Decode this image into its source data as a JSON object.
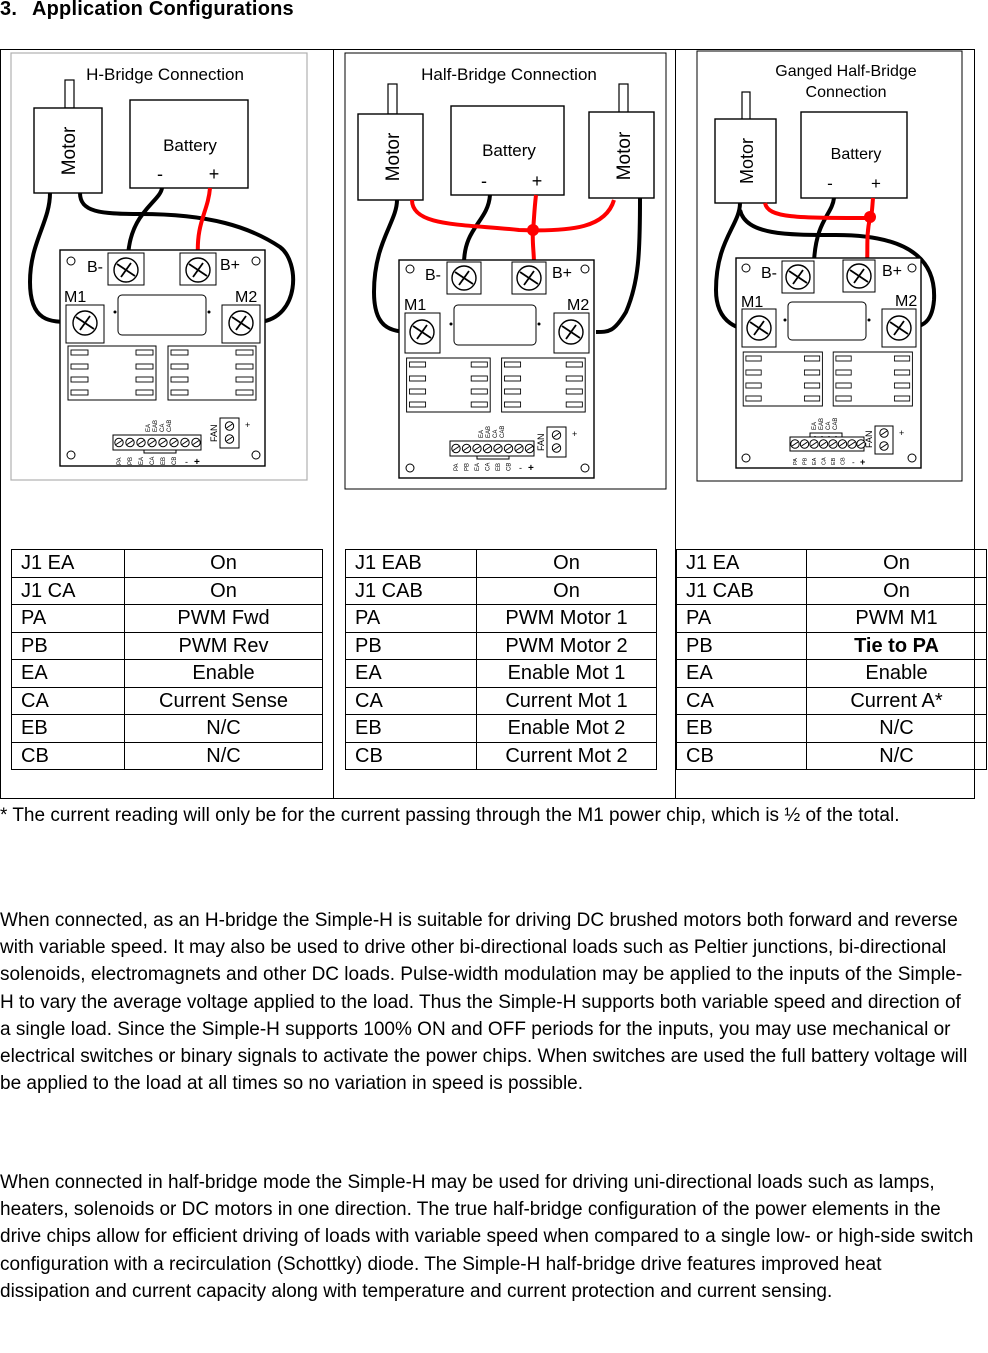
{
  "heading": {
    "number": "3.",
    "title": "Application Configurations"
  },
  "colors": {
    "wire_black": "#000000",
    "wire_red": "#ff0000",
    "panel_border": "#b0b0b0"
  },
  "diagrams": [
    {
      "title_lines": [
        "H-Bridge Connection"
      ],
      "motor_label": "Motor",
      "battery_label": "Battery",
      "battery_minus": "-",
      "battery_plus": "+",
      "board": {
        "b_minus": "B-",
        "b_plus": "B+",
        "m1": "M1",
        "m2": "M2",
        "jumper_labels": [
          "EA",
          "EAB",
          "CA",
          "CAB"
        ],
        "terminal_labels": [
          "PA",
          "PB",
          "EA",
          "CA",
          "EB",
          "CB",
          "-",
          "+"
        ],
        "fan_label": "FAN",
        "fan_plus": "+"
      }
    },
    {
      "title_lines": [
        "Half-Bridge Connection"
      ],
      "motor_label": "Motor",
      "motor2_label": "Motor",
      "battery_label": "Battery",
      "battery_minus": "-",
      "battery_plus": "+",
      "board": {
        "b_minus": "B-",
        "b_plus": "B+",
        "m1": "M1",
        "m2": "M2",
        "jumper_labels": [
          "EA",
          "EAB",
          "CA",
          "CAB"
        ],
        "terminal_labels": [
          "PA",
          "PB",
          "EA",
          "CA",
          "EB",
          "CB",
          "-",
          "+"
        ],
        "fan_label": "FAN",
        "fan_plus": "+"
      }
    },
    {
      "title_lines": [
        "Ganged Half-Bridge",
        "Connection"
      ],
      "motor_label": "Motor",
      "battery_label": "Battery",
      "battery_minus": "-",
      "battery_plus": "+",
      "board": {
        "b_minus": "B-",
        "b_plus": "B+",
        "m1": "M1",
        "m2": "M2",
        "jumper_labels": [
          "EA",
          "EAB",
          "CA",
          "CAB"
        ],
        "terminal_labels": [
          "PA",
          "PB",
          "EA",
          "CA",
          "EB",
          "CB",
          "-",
          "+"
        ],
        "fan_label": "FAN",
        "fan_plus": "+"
      }
    }
  ],
  "tables": [
    {
      "rows": [
        {
          "pin": "J1 EA",
          "value": "On"
        },
        {
          "pin": "J1 CA",
          "value": "On"
        },
        {
          "pin": "PA",
          "value": "PWM Fwd"
        },
        {
          "pin": "PB",
          "value": "PWM Rev"
        },
        {
          "pin": "EA",
          "value": "Enable"
        },
        {
          "pin": "CA",
          "value": "Current Sense"
        },
        {
          "pin": "EB",
          "value": "N/C"
        },
        {
          "pin": "CB",
          "value": "N/C"
        }
      ]
    },
    {
      "rows": [
        {
          "pin": "J1 EAB",
          "value": "On"
        },
        {
          "pin": "J1 CAB",
          "value": "On"
        },
        {
          "pin": "PA",
          "value": "PWM Motor 1"
        },
        {
          "pin": "PB",
          "value": "PWM Motor 2"
        },
        {
          "pin": "EA",
          "value": "Enable Mot 1"
        },
        {
          "pin": "CA",
          "value": "Current Mot 1"
        },
        {
          "pin": "EB",
          "value": "Enable Mot 2"
        },
        {
          "pin": "CB",
          "value": "Current Mot 2"
        }
      ]
    },
    {
      "rows": [
        {
          "pin": "J1 EA",
          "value": "On"
        },
        {
          "pin": "J1 CAB",
          "value": "On"
        },
        {
          "pin": "PA",
          "value": "PWM M1"
        },
        {
          "pin": "PB",
          "value": "Tie to PA",
          "bold": true
        },
        {
          "pin": "EA",
          "value": "Enable"
        },
        {
          "pin": "CA",
          "value": "Current A*"
        },
        {
          "pin": "EB",
          "value": "N/C"
        },
        {
          "pin": "CB",
          "value": "N/C"
        }
      ]
    }
  ],
  "footnote": "* The current reading will only be for the current passing through the M1 power chip, which is ½ of the total.",
  "paragraphs": [
    "When connected, as an H-bridge the Simple-H is suitable for driving DC brushed motors both forward and reverse with variable speed.  It may also be used to drive other bi-directional loads such as Peltier junctions, bi-directional solenoids, electromagnets and other DC loads.  Pulse-width modulation may be applied to the inputs of the Simple-H to vary the average voltage applied to the load.  Thus the Simple-H supports both variable speed and direction of a single load.  Since the Simple-H supports 100% ON and OFF periods for the inputs, you may use mechanical or electrical switches or binary signals to activate the power chips.  When switches are used the full battery voltage will be applied to the load at all times so no variation in speed is possible.",
    "When connected in half-bridge mode the Simple-H may be used for driving uni-directional loads such as lamps, heaters, solenoids or DC motors in one direction.  The true half-bridge configuration of the power elements in the drive chips allow for efficient driving of loads with variable speed when compared to a single low- or high-side switch configuration with a recirculation (Schottky) diode.  The Simple-H half-bridge drive features improved heat dissipation and current capacity along with temperature and current protection and current sensing."
  ]
}
